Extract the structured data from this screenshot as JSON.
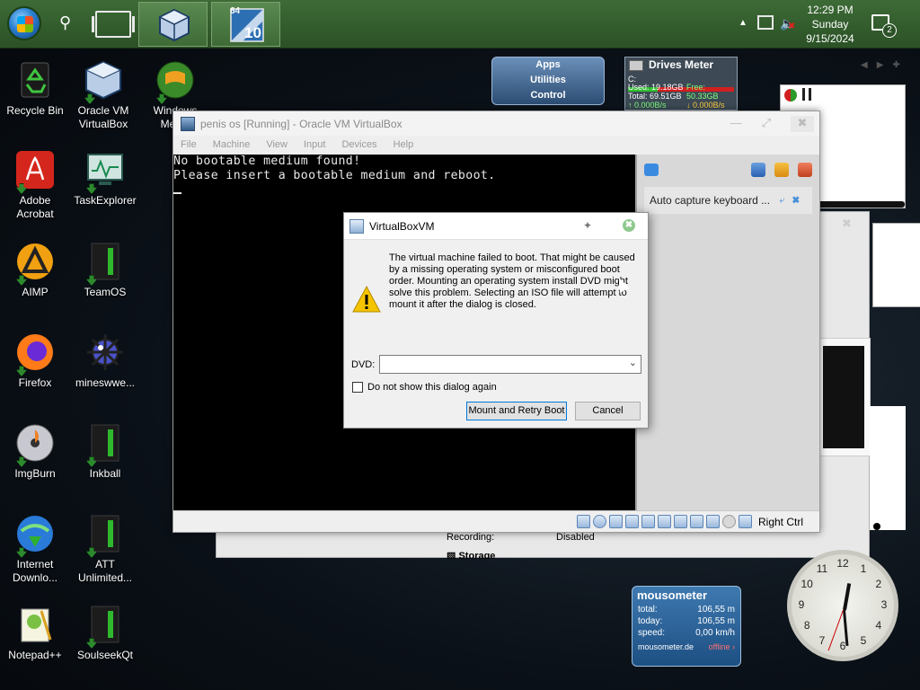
{
  "taskbar": {
    "clock_time": "12:29 PM",
    "clock_day": "Sunday",
    "clock_date": "9/15/2024",
    "notification_count": "2",
    "app2_badge_top": "64",
    "app2_badge_bottom": "10"
  },
  "desktop_icons": [
    {
      "label": "Recycle Bin"
    },
    {
      "label": "Oracle VM VirtualBox"
    },
    {
      "label": "Windows Media"
    },
    {
      "label": "Adobe Acrobat"
    },
    {
      "label": "TaskExplorer"
    },
    {
      "label": "AIMP"
    },
    {
      "label": "TeamOS"
    },
    {
      "label": "Firefox"
    },
    {
      "label": "mineswwe..."
    },
    {
      "label": "ImgBurn"
    },
    {
      "label": "Inkball"
    },
    {
      "label": "Internet Downlo..."
    },
    {
      "label": "ATT Unlimited..."
    },
    {
      "label": "Notepad++"
    },
    {
      "label": "SoulseekQt"
    }
  ],
  "gadgets": {
    "apps_menu": [
      "Apps",
      "Utilities",
      "Control"
    ],
    "drives_meter": {
      "title": "Drives Meter",
      "drive": "C:",
      "used": "Used: 19.18GB",
      "free": "Free: 50.33GB",
      "total": "Total: 69.51GB",
      "read": "0.000B/s",
      "write": "0.000B/s",
      "used_fraction": 0.28
    },
    "mousometer": {
      "title": "mousometer",
      "rows": [
        {
          "k": "total:",
          "v": "106,55 m"
        },
        {
          "k": "today:",
          "v": "106,55 m"
        },
        {
          "k": "speed:",
          "v": "0,00 km/h"
        }
      ],
      "site": "mousometer.de",
      "status": "offline"
    },
    "clock_numbers": [
      "12",
      "1",
      "2",
      "3",
      "4",
      "5",
      "6",
      "7",
      "8",
      "9",
      "10",
      "11"
    ]
  },
  "background_window": {
    "recording_label": "Recording:",
    "recording_value": "Disabled",
    "storage_label": "Storage"
  },
  "vbox": {
    "title": "penis os [Running] - Oracle VM VirtualBox",
    "menu": [
      "File",
      "Machine",
      "View",
      "Input",
      "Devices",
      "Help"
    ],
    "screen_line1": "No bootable medium found!",
    "screen_line2": "Please insert a bootable medium and reboot.",
    "side_popup": "Auto capture keyboard ...",
    "host_key": "Right Ctrl"
  },
  "dialog": {
    "title": "VirtualBoxVM",
    "message": "The virtual machine failed to boot. That might be caused by a missing operating system or misconfigured boot order. Mounting an operating system install DVD might solve this problem. Selecting an ISO file will attempt to mount it after the dialog is closed.",
    "dvd_label": "DVD:",
    "dvd_value": "",
    "checkbox_label": "Do not show this dialog again",
    "mount_button": "Mount and Retry Boot",
    "cancel_button": "Cancel"
  },
  "colors": {
    "taskbar": "#2b5126",
    "vm_screen": "#000000",
    "dialog_bg": "#f0f0f0",
    "warning": "#f5c400"
  }
}
